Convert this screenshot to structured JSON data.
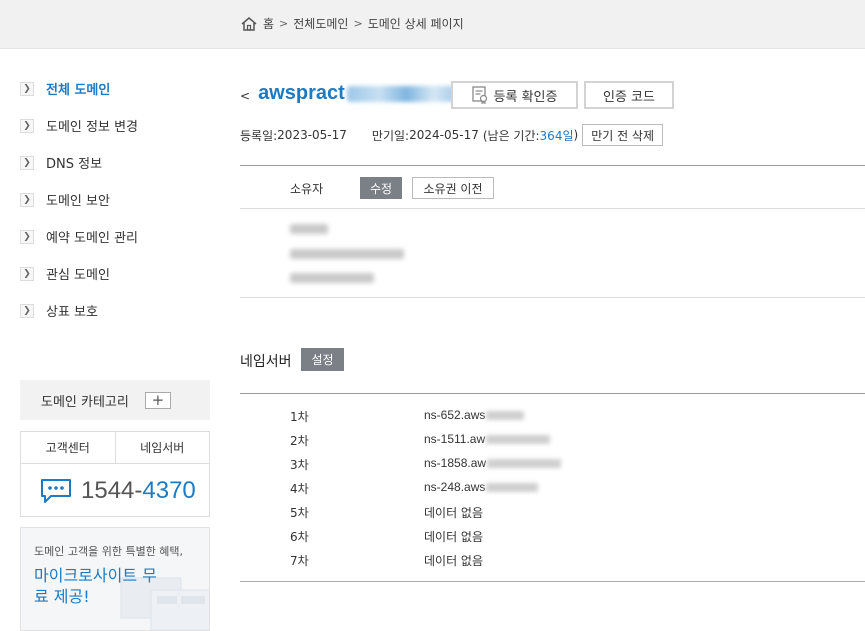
{
  "breadcrumb": {
    "home": "홈",
    "items": [
      "전체도메인",
      "도메인 상세 페이지"
    ],
    "sep": ">"
  },
  "sidebar": {
    "items": [
      {
        "label": "전체 도메인",
        "active": true
      },
      {
        "label": "도메인 정보 변경",
        "active": false
      },
      {
        "label": "DNS 정보",
        "active": false
      },
      {
        "label": "도메인 보안",
        "active": false
      },
      {
        "label": "예약 도메인 관리",
        "active": false
      },
      {
        "label": "관심 도메인",
        "active": false
      },
      {
        "label": "상표 보호",
        "active": false
      }
    ],
    "category": {
      "label": "도메인 카테고리",
      "add": "+"
    },
    "support": {
      "tab1": "고객센터",
      "tab2": "네임서버",
      "phone_prefix": "1544-",
      "phone_suffix": "4370"
    },
    "promo": {
      "line1": "도메인 고객을 위한 특별한 혜택,",
      "line2": "마이크로사이트 무료 제공!"
    }
  },
  "domain": {
    "back": "<",
    "name_visible": "awspract",
    "cert_button": "등록 확인증",
    "code_button": "인증 코드",
    "registered_label": "등록일: ",
    "registered": "2023-05-17",
    "expires_label": "만기일: ",
    "expires": "2024-05-17",
    "remaining_prefix": "(남은 기간: ",
    "remaining_days": "364일",
    "remaining_suffix": " )",
    "delete_button": "만기 전 삭제"
  },
  "owner": {
    "label": "소유자",
    "edit_button": "수정",
    "transfer_button": "소유권 이전"
  },
  "nameserver": {
    "title": "네임서버",
    "set_button": "설정",
    "rows": [
      {
        "order": "1차",
        "value": "ns-652.aws"
      },
      {
        "order": "2차",
        "value": "ns-1511.aw"
      },
      {
        "order": "3차",
        "value": "ns-1858.aw"
      },
      {
        "order": "4차",
        "value": "ns-248.aws"
      },
      {
        "order": "5차",
        "value": "데이터 없음"
      },
      {
        "order": "6차",
        "value": "데이터 없음"
      },
      {
        "order": "7차",
        "value": "데이터 없음"
      }
    ]
  },
  "colors": {
    "accent": "#1b7bc4",
    "button_gray": "#7a8086"
  }
}
